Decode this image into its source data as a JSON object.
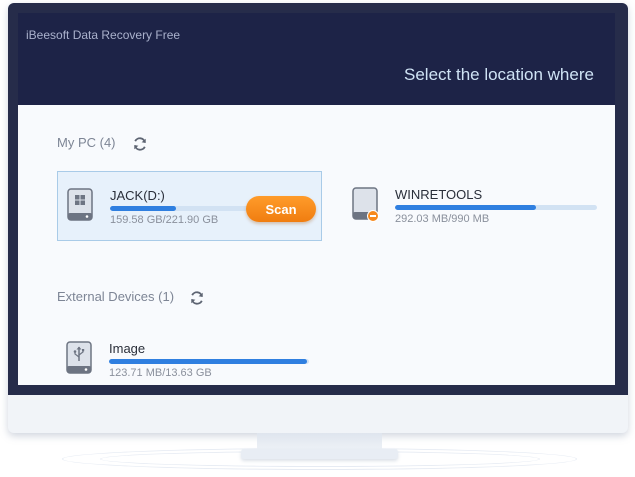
{
  "app": {
    "title": "iBeesoft Data Recovery Free",
    "heading": "Select the location where"
  },
  "my_pc": {
    "label": "My PC (4)",
    "drives": [
      {
        "name": "JACK(D:)",
        "size_text": "159.58 GB/221.90 GB",
        "used_fraction": 0.32,
        "selected": true,
        "icon": "windows-drive-icon",
        "scan_label": "Scan"
      },
      {
        "name": "WINRETOOLS",
        "size_text": "292.03 MB/990 MB",
        "used_fraction": 0.7,
        "selected": false,
        "icon": "drive-warning-icon"
      }
    ]
  },
  "external": {
    "label": "External Devices (1)",
    "devices": [
      {
        "name": "Image",
        "size_text": "123.71 MB/13.63 GB",
        "used_fraction": 0.99,
        "icon": "usb-drive-icon"
      }
    ]
  },
  "colors": {
    "header_bg": "#1d2347",
    "content_bg": "#f8fafd",
    "accent_blue": "#2f7fe0",
    "scan_orange": "#f7891c"
  }
}
